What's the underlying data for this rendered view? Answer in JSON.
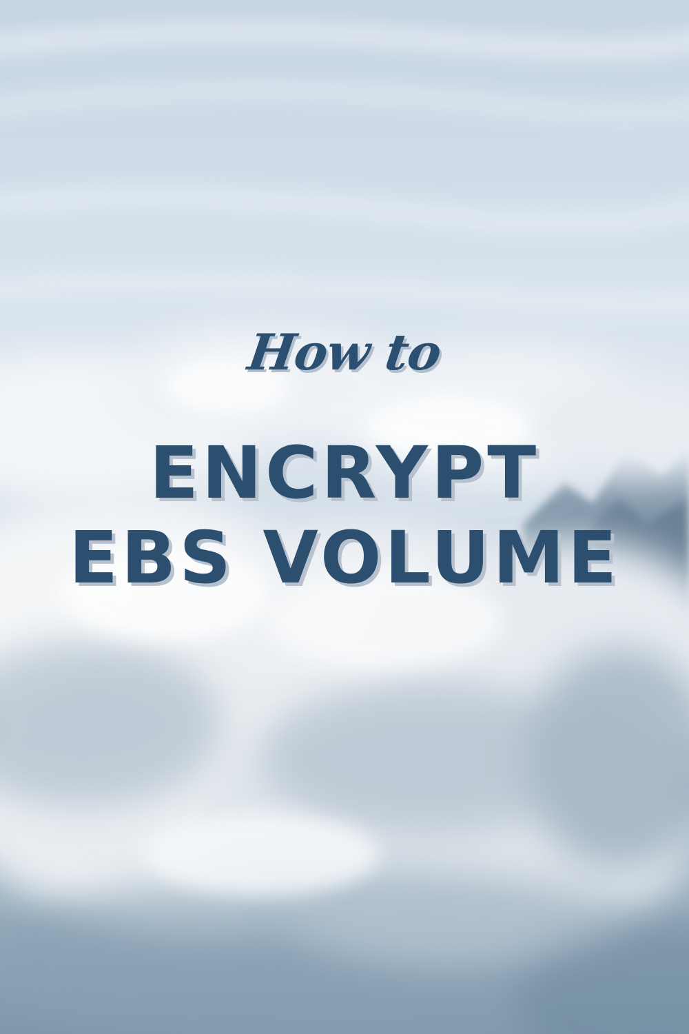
{
  "title": {
    "kicker": "How to",
    "line1": "ENCRYPT",
    "line2": "EBS VOLUME"
  },
  "colors": {
    "text": "#2c4f70",
    "shadow": "#b8c2ce",
    "sky": "#d6e0ea",
    "cloud": "#eef1f4",
    "mountain": "#6f879c"
  }
}
